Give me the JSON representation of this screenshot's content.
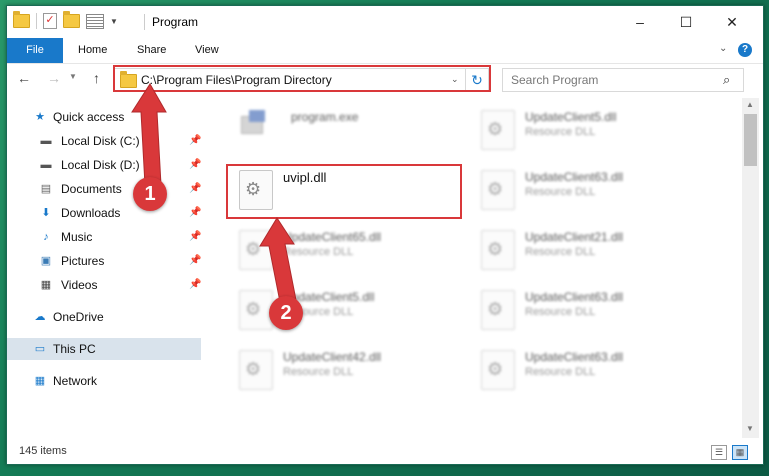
{
  "window": {
    "title": "Program",
    "controls": {
      "minimize": "–",
      "maximize": "☐",
      "close": "✕"
    }
  },
  "ribbon": {
    "tabs": [
      {
        "label": "File"
      },
      {
        "label": "Home"
      },
      {
        "label": "Share"
      },
      {
        "label": "View"
      }
    ],
    "help": "?"
  },
  "navbar": {
    "address": "C:\\Program Files\\Program Directory",
    "search_placeholder": "Search Program"
  },
  "sidebar": {
    "items": [
      {
        "label": "Quick access",
        "icon": "star-icon"
      },
      {
        "label": "Local Disk (C:)",
        "icon": "drive-icon",
        "pinned": true
      },
      {
        "label": "Local Disk (D:)",
        "icon": "drive-icon",
        "pinned": true
      },
      {
        "label": "Documents",
        "icon": "documents-icon",
        "pinned": true
      },
      {
        "label": "Downloads",
        "icon": "downloads-icon",
        "pinned": true
      },
      {
        "label": "Music",
        "icon": "music-icon",
        "pinned": true
      },
      {
        "label": "Pictures",
        "icon": "pictures-icon",
        "pinned": true
      },
      {
        "label": "Videos",
        "icon": "videos-icon",
        "pinned": true
      },
      {
        "label": "OneDrive",
        "icon": "cloud-icon"
      },
      {
        "label": "This PC",
        "icon": "computer-icon",
        "selected": true
      },
      {
        "label": "Network",
        "icon": "network-icon"
      }
    ]
  },
  "files": [
    {
      "name": "program.exe",
      "type": ""
    },
    {
      "name": "UpdateClient5.dll",
      "type": "Resource DLL"
    },
    {
      "name": "uvipl.dll",
      "type": ""
    },
    {
      "name": "UpdateClient63.dll",
      "type": "Resource DLL"
    },
    {
      "name": "UpdateClient65.dll",
      "type": "Resource DLL"
    },
    {
      "name": "UpdateClient21.dll",
      "type": "Resource DLL"
    },
    {
      "name": "UpdateClient5.dll",
      "type": "Resource DLL"
    },
    {
      "name": "UpdateClient63.dll",
      "type": "Resource DLL"
    },
    {
      "name": "UpdateClient42.dll",
      "type": "Resource DLL"
    },
    {
      "name": "UpdateClient63.dll",
      "type": "Resource DLL"
    }
  ],
  "status": {
    "item_count": "145 items"
  },
  "annotations": {
    "step1": "1",
    "step2": "2"
  },
  "colors": {
    "accent": "#1979ca",
    "highlight": "#d9383a",
    "selected": "#d9e3ec"
  }
}
